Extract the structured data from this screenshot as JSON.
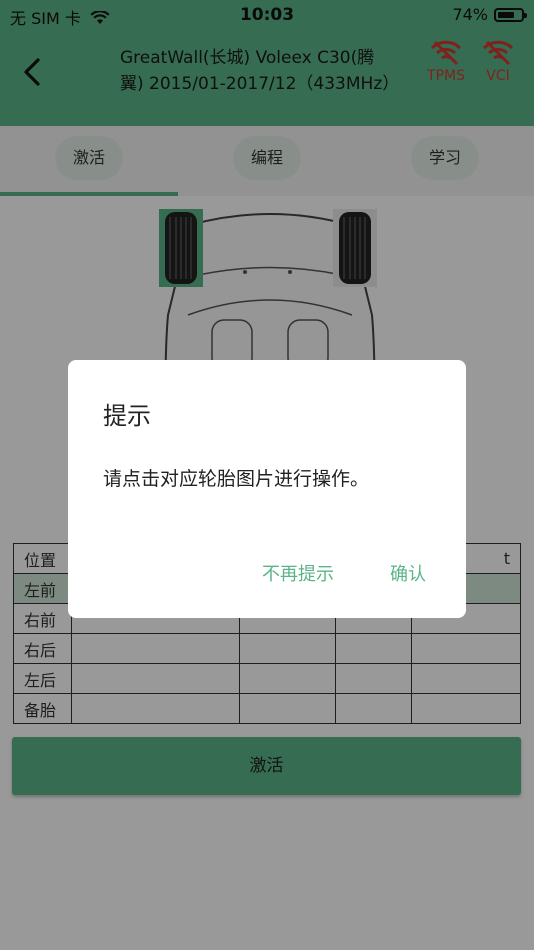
{
  "status_bar": {
    "carrier": "无 SIM 卡",
    "time": "10:03",
    "battery": "74%",
    "battery_level": 0.74
  },
  "header": {
    "title_line1": "GreatWall(长城) Voleex C30(腾",
    "title_line2": "翼) 2015/01-2017/12（433MHz）",
    "status_icons": [
      {
        "label": "TPMS",
        "icon": "wifi-off-icon"
      },
      {
        "label": "VCI",
        "icon": "wifi-off-icon"
      }
    ],
    "accent_color": "#5bb488",
    "alert_color": "#d43a32"
  },
  "tabs": [
    {
      "label": "激活",
      "selected": true
    },
    {
      "label": "编程",
      "selected": false
    },
    {
      "label": "学习",
      "selected": false
    }
  ],
  "table": {
    "header_first": "位置",
    "header_last_partial": "t",
    "rows": [
      "左前",
      "右前",
      "右后",
      "左后",
      "备胎"
    ],
    "selected_row": "左前"
  },
  "activate_button": "激活",
  "dialog": {
    "title": "提示",
    "message": "请点击对应轮胎图片进行操作。",
    "dont_remind": "不再提示",
    "confirm": "确认"
  }
}
